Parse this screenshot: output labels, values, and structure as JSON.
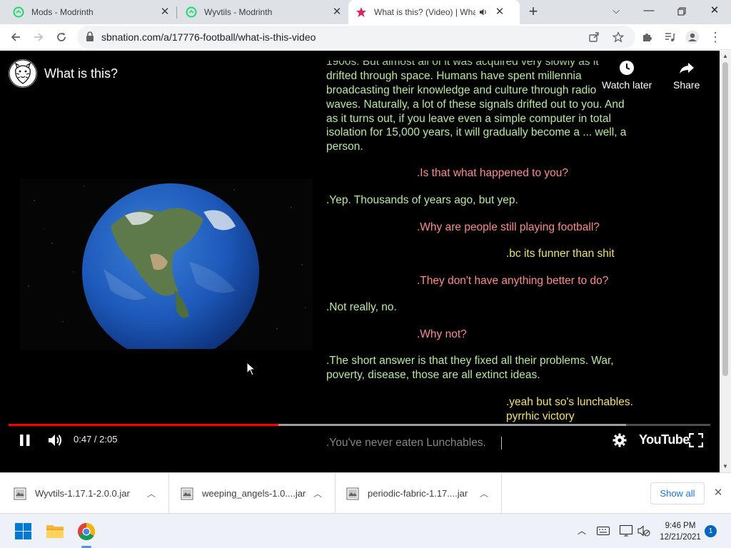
{
  "browser": {
    "tabs": [
      {
        "title": "Mods - Modrinth",
        "active": false
      },
      {
        "title": "Wyvtils - Modrinth",
        "active": false
      },
      {
        "title": "What is this? (Video) | What i",
        "active": true
      }
    ],
    "url": "sbnation.com/a/17776-football/what-is-this-video"
  },
  "video": {
    "title": "What is this?",
    "watch_later": "Watch later",
    "share": "Share",
    "time": "0:47 / 2:05",
    "brand": "YouTube",
    "played_fraction": 0.385,
    "buffered_fraction": 0.88
  },
  "chat_lines": [
    {
      "text": "1900s. But almost all of it was acquired very slowly as it",
      "color": "green"
    },
    {
      "text": "drifted through space. Humans have spent millennia",
      "color": "green"
    },
    {
      "text": "broadcasting their knowledge and culture through radio",
      "color": "green"
    },
    {
      "text": "waves. Naturally, a lot of these signals drifted out to you. And",
      "color": "green"
    },
    {
      "text": "as it turns out, if you leave even a simple computer in total",
      "color": "green"
    },
    {
      "text": "isolation for 15,000 years, it will gradually become a ... well, a",
      "color": "green"
    },
    {
      "text": "person.",
      "color": "green"
    },
    {
      "text": ".Is that what happened to you?",
      "color": "pink"
    },
    {
      "text": ".Yep. Thousands of years ago, but yep.",
      "color": "green"
    },
    {
      "text": ".Why are people still playing football?",
      "color": "pink"
    },
    {
      "text": ".bc its funner than shit",
      "color": "yellow"
    },
    {
      "text": ".They don't have anything better to do?",
      "color": "pink"
    },
    {
      "text": ".Not really, no.",
      "color": "green"
    },
    {
      "text": ".Why not?",
      "color": "pink"
    },
    {
      "text": ".The short answer is that they fixed all their problems. War,",
      "color": "green"
    },
    {
      "text": "poverty, disease, those are all extinct ideas.",
      "color": "green"
    },
    {
      "text": ".yeah but so's lunchables.",
      "color": "yellow"
    },
    {
      "text": "pyrrhic victory",
      "color": "yellow"
    },
    {
      "text": ".You've never eaten Lunchables.",
      "color": "dim"
    }
  ],
  "downloads": {
    "items": [
      "Wyvtils-1.17.1-2.0.0.jar",
      "weeping_angels-1.0....jar",
      "periodic-fabric-1.17....jar"
    ],
    "show_all": "Show all"
  },
  "taskbar": {
    "time": "9:46 PM",
    "date": "12/21/2021",
    "notifications": "1"
  },
  "colors": {
    "progress_played": "#ff0000",
    "chat_green": "#b8e8a0",
    "chat_pink": "#ff8a8a",
    "chat_yellow": "#f0e070"
  }
}
